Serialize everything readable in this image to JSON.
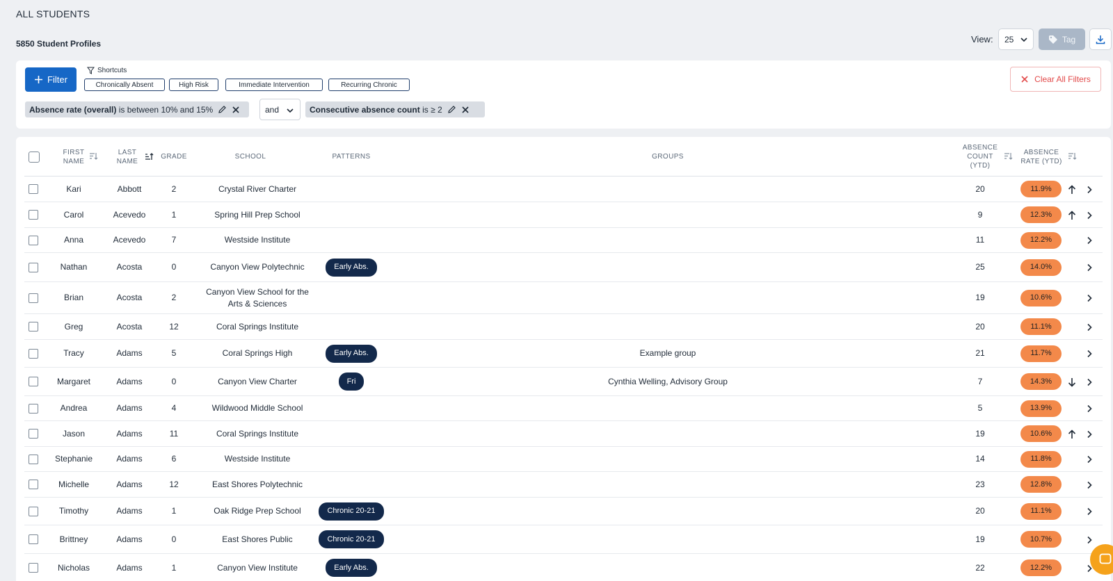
{
  "page": {
    "title": "ALL STUDENTS",
    "profile_count": "5850 Student Profiles"
  },
  "toolbar": {
    "view_label": "View:",
    "view_value": "25",
    "tag_label": "Tag"
  },
  "filters": {
    "filter_button": "Filter",
    "shortcuts_label": "Shortcuts",
    "shortcuts": [
      "Chronically Absent",
      "High Risk",
      "Immediate Intervention",
      "Recurring Chronic"
    ],
    "clear_all": "Clear All Filters",
    "conjunction": "and",
    "active": [
      {
        "field": "Absence rate (overall)",
        "condition": "is between 10% and 15%"
      },
      {
        "field": "Consecutive absence count",
        "condition": "is ≥ 2"
      }
    ]
  },
  "table": {
    "headers": {
      "first_name": "FIRST NAME",
      "last_name": "LAST NAME",
      "grade": "GRADE",
      "school": "SCHOOL",
      "patterns": "PATTERNS",
      "groups": "GROUPS",
      "absence_count": "ABSENCE COUNT (YTD)",
      "absence_rate": "ABSENCE RATE (YTD)"
    },
    "rows": [
      {
        "first": "Kari",
        "last": "Abbott",
        "grade": "2",
        "school": "Crystal River Charter",
        "pattern": "",
        "groups": "",
        "count": "20",
        "rate": "11.9%",
        "trend": "up"
      },
      {
        "first": "Carol",
        "last": "Acevedo",
        "grade": "1",
        "school": "Spring Hill Prep School",
        "pattern": "",
        "groups": "",
        "count": "9",
        "rate": "12.3%",
        "trend": "up"
      },
      {
        "first": "Anna",
        "last": "Acevedo",
        "grade": "7",
        "school": "Westside Institute",
        "pattern": "",
        "groups": "",
        "count": "11",
        "rate": "12.2%",
        "trend": ""
      },
      {
        "first": "Nathan",
        "last": "Acosta",
        "grade": "0",
        "school": "Canyon View Polytechnic",
        "pattern": "Early Abs.",
        "groups": "",
        "count": "25",
        "rate": "14.0%",
        "trend": ""
      },
      {
        "first": "Brian",
        "last": "Acosta",
        "grade": "2",
        "school": "Canyon View School for the Arts & Sciences",
        "pattern": "",
        "groups": "",
        "count": "19",
        "rate": "10.6%",
        "trend": ""
      },
      {
        "first": "Greg",
        "last": "Acosta",
        "grade": "12",
        "school": "Coral Springs Institute",
        "pattern": "",
        "groups": "",
        "count": "20",
        "rate": "11.1%",
        "trend": ""
      },
      {
        "first": "Tracy",
        "last": "Adams",
        "grade": "5",
        "school": "Coral Springs High",
        "pattern": "Early Abs.",
        "groups": "Example group",
        "count": "21",
        "rate": "11.7%",
        "trend": ""
      },
      {
        "first": "Margaret",
        "last": "Adams",
        "grade": "0",
        "school": "Canyon View Charter",
        "pattern": "Fri",
        "groups": "Cynthia Welling, Advisory Group",
        "count": "7",
        "rate": "14.3%",
        "trend": "down"
      },
      {
        "first": "Andrea",
        "last": "Adams",
        "grade": "4",
        "school": "Wildwood Middle School",
        "pattern": "",
        "groups": "",
        "count": "5",
        "rate": "13.9%",
        "trend": ""
      },
      {
        "first": "Jason",
        "last": "Adams",
        "grade": "11",
        "school": "Coral Springs Institute",
        "pattern": "",
        "groups": "",
        "count": "19",
        "rate": "10.6%",
        "trend": "up"
      },
      {
        "first": "Stephanie",
        "last": "Adams",
        "grade": "6",
        "school": "Westside Institute",
        "pattern": "",
        "groups": "",
        "count": "14",
        "rate": "11.8%",
        "trend": ""
      },
      {
        "first": "Michelle",
        "last": "Adams",
        "grade": "12",
        "school": "East Shores Polytechnic",
        "pattern": "",
        "groups": "",
        "count": "23",
        "rate": "12.8%",
        "trend": ""
      },
      {
        "first": "Timothy",
        "last": "Adams",
        "grade": "1",
        "school": "Oak Ridge Prep School",
        "pattern": "Chronic 20-21",
        "groups": "",
        "count": "20",
        "rate": "11.1%",
        "trend": ""
      },
      {
        "first": "Brittney",
        "last": "Adams",
        "grade": "0",
        "school": "East Shores Public",
        "pattern": "Chronic 20-21",
        "groups": "",
        "count": "19",
        "rate": "10.7%",
        "trend": ""
      },
      {
        "first": "Nicholas",
        "last": "Adams",
        "grade": "1",
        "school": "Canyon View Institute",
        "pattern": "Early Abs.",
        "groups": "",
        "count": "22",
        "rate": "12.2%",
        "trend": ""
      }
    ]
  },
  "colors": {
    "primary": "#1667c6",
    "pattern_badge": "#13294b",
    "rate_badge": "#f3894a",
    "danger": "#e24a4a",
    "chat": "#f5a21b"
  },
  "icons": [
    "plus-icon",
    "funnel-icon",
    "close-icon",
    "pencil-icon",
    "chevron-down-icon",
    "tag-icon",
    "download-icon",
    "sort-icon",
    "arrow-up-icon",
    "arrow-down-icon",
    "chevron-right-icon",
    "chat-icon"
  ]
}
